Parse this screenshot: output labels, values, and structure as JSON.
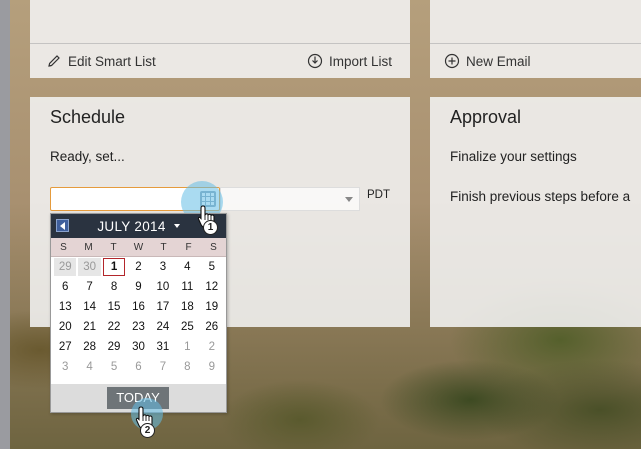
{
  "top_left_panel": {
    "edit_smart_list_label": "Edit Smart List",
    "import_list_label": "Import List"
  },
  "top_right_panel": {
    "new_email_label": "New Email"
  },
  "schedule": {
    "title": "Schedule",
    "status_text": "Ready, set...",
    "date_value": "",
    "time_value": "",
    "timezone": "PDT"
  },
  "approval": {
    "title": "Approval",
    "line1": "Finalize your settings",
    "line2": "Finish previous steps before a"
  },
  "calendar": {
    "month_label": "JULY 2014",
    "weekdays": [
      "S",
      "M",
      "T",
      "W",
      "T",
      "F",
      "S"
    ],
    "today_label": "TODAY",
    "selected_day": 1,
    "weeks": [
      [
        "29",
        "30",
        "1",
        "2",
        "3",
        "4",
        "5"
      ],
      [
        "6",
        "7",
        "8",
        "9",
        "10",
        "11",
        "12"
      ],
      [
        "13",
        "14",
        "15",
        "16",
        "17",
        "18",
        "19"
      ],
      [
        "20",
        "21",
        "22",
        "23",
        "24",
        "25",
        "26"
      ],
      [
        "27",
        "28",
        "29",
        "30",
        "31",
        "1",
        "2"
      ],
      [
        "3",
        "4",
        "5",
        "6",
        "7",
        "8",
        "9"
      ]
    ]
  },
  "annotations": {
    "step1": "1",
    "step2": "2"
  },
  "colors": {
    "accent_border": "#e59b3c",
    "calendar_header": "#2a3340",
    "today_outline": "#b3262b",
    "click_highlight": "#64bee6"
  }
}
